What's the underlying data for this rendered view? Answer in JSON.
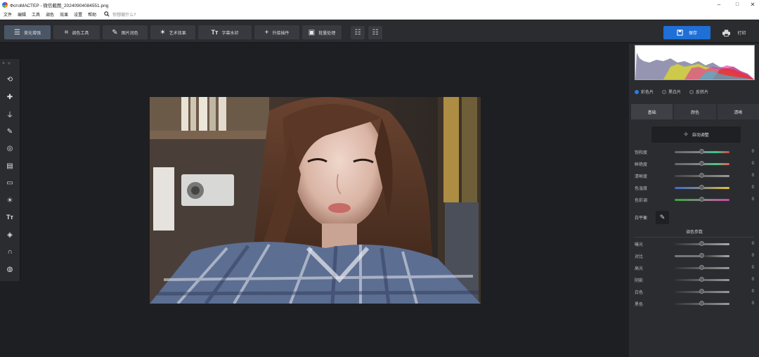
{
  "window": {
    "title": "ФотоМАСТЕР - 微信截图_20240904084551.png",
    "controls": [
      "–",
      "□",
      "✕"
    ]
  },
  "menu": {
    "items": [
      "文件",
      "编辑",
      "工具",
      "调色",
      "效果",
      "设置",
      "帮助"
    ],
    "search_placeholder": "你想做什么?"
  },
  "toolbar": {
    "buttons": [
      {
        "label": "美化增强",
        "icon": "sliders-icon",
        "active": true
      },
      {
        "label": "调色工具",
        "icon": "crop-icon"
      },
      {
        "label": "图片润色",
        "icon": "brush-icon"
      },
      {
        "label": "艺术效果",
        "icon": "magic-wand-icon"
      },
      {
        "label": "字幕水印",
        "icon": "text-icon"
      },
      {
        "label": "外接插件",
        "icon": "plus-icon"
      },
      {
        "label": "批量处理",
        "icon": "batch-icon"
      }
    ],
    "save_label": "保存",
    "print_label": "打印"
  },
  "left_tools": [
    "rotate-icon",
    "healing-icon",
    "stamp-icon",
    "brush-icon",
    "radial-icon",
    "gradient-icon",
    "vignette-icon",
    "light-icon",
    "text-icon",
    "fill-icon",
    "magnet-icon",
    "face-icon"
  ],
  "right_panel": {
    "color_modes": [
      {
        "label": "彩色片",
        "selected": true
      },
      {
        "label": "黑白片",
        "selected": false
      },
      {
        "label": "反转片",
        "selected": false
      }
    ],
    "tabs": [
      {
        "label": "基础",
        "active": true
      },
      {
        "label": "颜色",
        "active": false
      },
      {
        "label": "清晰",
        "active": false
      }
    ],
    "auto_label": "自动调整",
    "basic_sliders": [
      {
        "label": "饱和度",
        "value": "0"
      },
      {
        "label": "鲜艳度",
        "value": "0"
      },
      {
        "label": "清晰度",
        "value": "0"
      },
      {
        "label": "色温度",
        "value": "0"
      },
      {
        "label": "色彩调",
        "value": "0"
      }
    ],
    "white_balance_label": "白平衡",
    "tone_section_title": "调色参数",
    "tone_sliders": [
      {
        "label": "曝光",
        "value": "0"
      },
      {
        "label": "对比",
        "value": "0"
      },
      {
        "label": "高光",
        "value": "0"
      },
      {
        "label": "阴影",
        "value": "0"
      },
      {
        "label": "白色",
        "value": "0"
      },
      {
        "label": "黑色",
        "value": "0"
      }
    ]
  },
  "colors": {
    "accent": "#1f6fd6",
    "panel": "#2b2c30",
    "canvas": "#1e1f22"
  }
}
